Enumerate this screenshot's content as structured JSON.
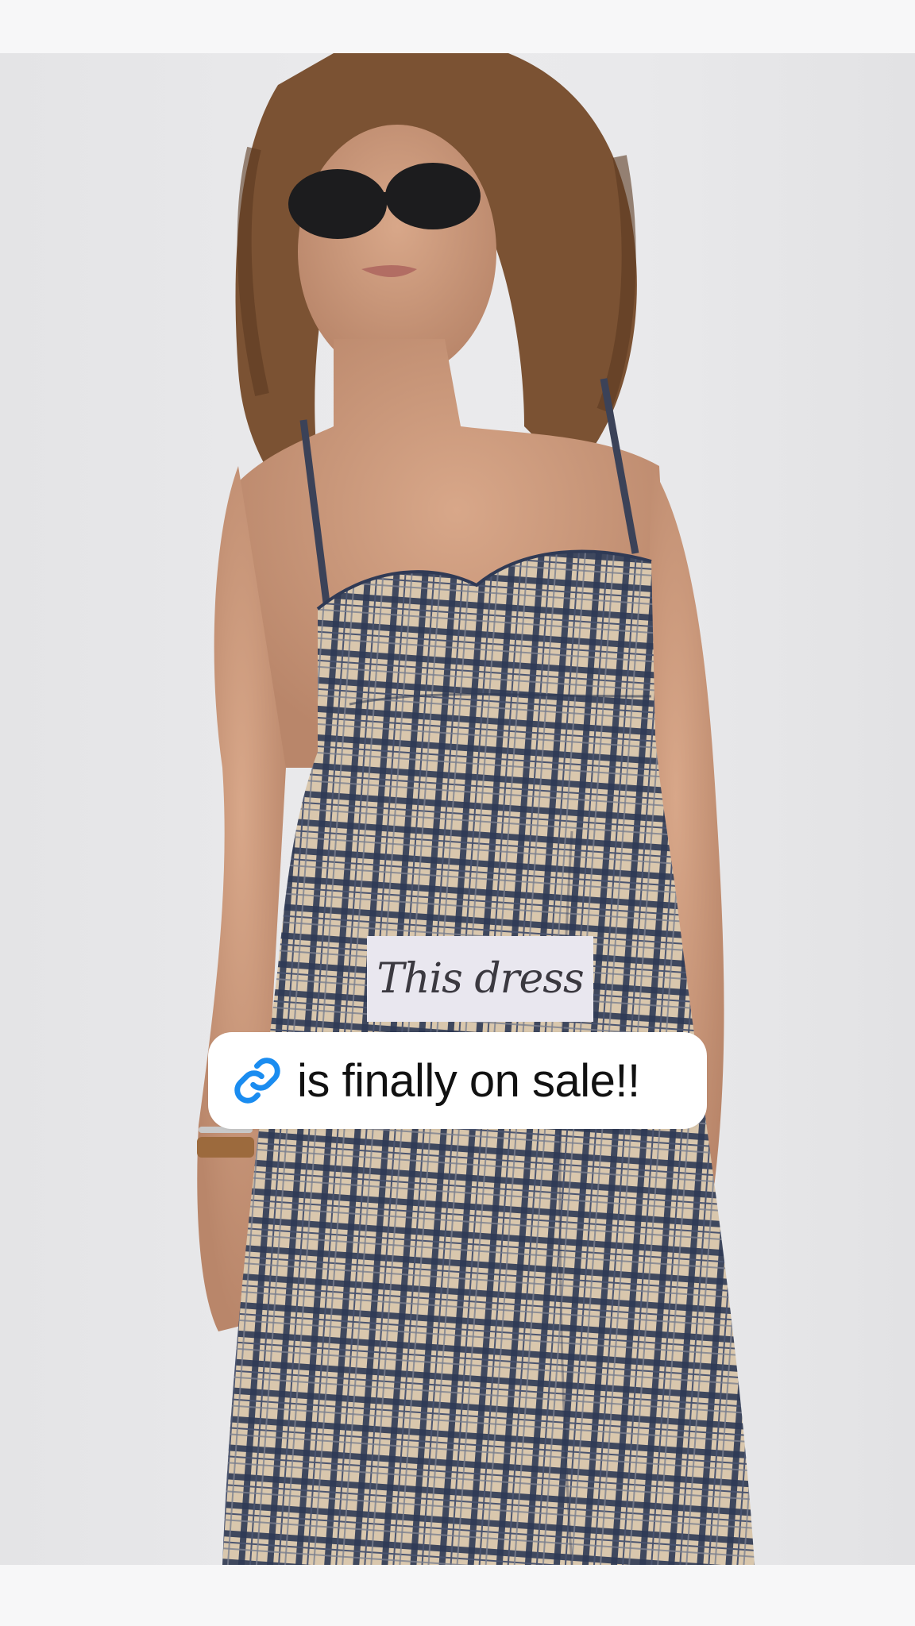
{
  "story": {
    "caption": "This dress",
    "link_sticker": {
      "text": "is finally on sale!!",
      "icon": "link-icon",
      "icon_color": "#1a8cf0"
    }
  },
  "colors": {
    "background": "#f7f7f8",
    "caption_bg": "#e9e7ef",
    "sticker_bg": "#ffffff"
  }
}
